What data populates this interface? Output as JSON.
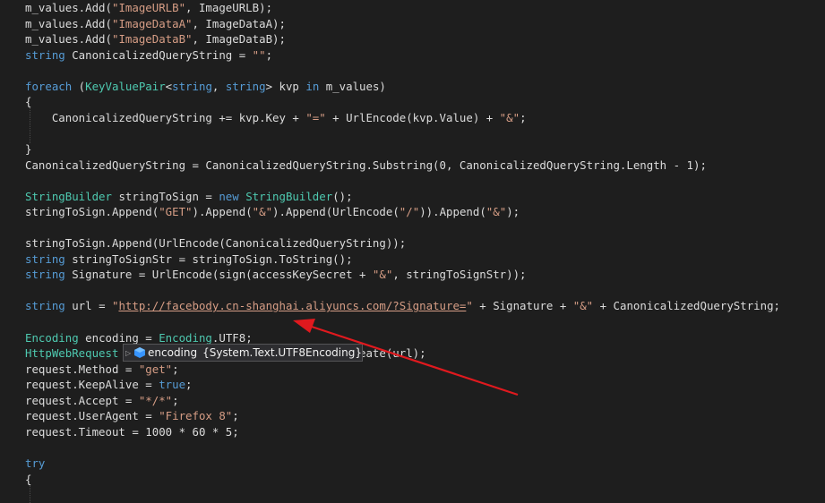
{
  "code_lines": [
    [
      {
        "t": "m_values.Add(",
        "c": "plain"
      },
      {
        "t": "\"ImageURLB\"",
        "c": "str"
      },
      {
        "t": ", ImageURLB);",
        "c": "plain"
      }
    ],
    [
      {
        "t": "m_values.Add(",
        "c": "plain"
      },
      {
        "t": "\"ImageDataA\"",
        "c": "str"
      },
      {
        "t": ", ImageDataA);",
        "c": "plain"
      }
    ],
    [
      {
        "t": "m_values.Add(",
        "c": "plain"
      },
      {
        "t": "\"ImageDataB\"",
        "c": "str"
      },
      {
        "t": ", ImageDataB);",
        "c": "plain"
      }
    ],
    [
      {
        "t": "string",
        "c": "kw"
      },
      {
        "t": " CanonicalizedQueryString = ",
        "c": "plain"
      },
      {
        "t": "\"\"",
        "c": "str"
      },
      {
        "t": ";",
        "c": "plain"
      }
    ],
    [],
    [
      {
        "t": "foreach",
        "c": "kw"
      },
      {
        "t": " (",
        "c": "plain"
      },
      {
        "t": "KeyValuePair",
        "c": "type"
      },
      {
        "t": "<",
        "c": "plain"
      },
      {
        "t": "string",
        "c": "kw"
      },
      {
        "t": ", ",
        "c": "plain"
      },
      {
        "t": "string",
        "c": "kw"
      },
      {
        "t": "> kvp ",
        "c": "plain"
      },
      {
        "t": "in",
        "c": "kw"
      },
      {
        "t": " m_values)",
        "c": "plain"
      }
    ],
    [
      {
        "t": "{",
        "c": "plain"
      }
    ],
    [
      {
        "t": "    CanonicalizedQueryString += kvp.Key + ",
        "c": "plain"
      },
      {
        "t": "\"=\"",
        "c": "str"
      },
      {
        "t": " + UrlEncode(kvp.Value) + ",
        "c": "plain"
      },
      {
        "t": "\"&\"",
        "c": "str"
      },
      {
        "t": ";",
        "c": "plain"
      }
    ],
    [],
    [
      {
        "t": "}",
        "c": "plain"
      }
    ],
    [
      {
        "t": "CanonicalizedQueryString = CanonicalizedQueryString.Substring(0, CanonicalizedQueryString.Length - 1);",
        "c": "plain"
      }
    ],
    [],
    [
      {
        "t": "StringBuilder",
        "c": "type"
      },
      {
        "t": " stringToSign = ",
        "c": "plain"
      },
      {
        "t": "new",
        "c": "kw"
      },
      {
        "t": " ",
        "c": "plain"
      },
      {
        "t": "StringBuilder",
        "c": "type"
      },
      {
        "t": "();",
        "c": "plain"
      }
    ],
    [
      {
        "t": "stringToSign.Append(",
        "c": "plain"
      },
      {
        "t": "\"GET\"",
        "c": "str"
      },
      {
        "t": ").Append(",
        "c": "plain"
      },
      {
        "t": "\"&\"",
        "c": "str"
      },
      {
        "t": ").Append(UrlEncode(",
        "c": "plain"
      },
      {
        "t": "\"/\"",
        "c": "str"
      },
      {
        "t": ")).Append(",
        "c": "plain"
      },
      {
        "t": "\"&\"",
        "c": "str"
      },
      {
        "t": ");",
        "c": "plain"
      }
    ],
    [],
    [
      {
        "t": "stringToSign.Append(UrlEncode(CanonicalizedQueryString));",
        "c": "plain"
      }
    ],
    [
      {
        "t": "string",
        "c": "kw"
      },
      {
        "t": " stringToSignStr = stringToSign.ToString();",
        "c": "plain"
      }
    ],
    [
      {
        "t": "string",
        "c": "kw"
      },
      {
        "t": " Signature = UrlEncode(sign(accessKeySecret + ",
        "c": "plain"
      },
      {
        "t": "\"&\"",
        "c": "str"
      },
      {
        "t": ", stringToSignStr));",
        "c": "plain"
      }
    ],
    [],
    [
      {
        "t": "string",
        "c": "kw"
      },
      {
        "t": " url = ",
        "c": "plain"
      },
      {
        "t": "\"",
        "c": "str"
      },
      {
        "t": "http://facebody.cn-shanghai.aliyuncs.com/?Signature=",
        "c": "url"
      },
      {
        "t": "\"",
        "c": "str"
      },
      {
        "t": " + Signature + ",
        "c": "plain"
      },
      {
        "t": "\"&\"",
        "c": "str"
      },
      {
        "t": " + CanonicalizedQueryString;",
        "c": "plain"
      }
    ],
    [],
    [
      {
        "t": "Encoding",
        "c": "type"
      },
      {
        "t": " encoding = ",
        "c": "plain"
      },
      {
        "t": "Encoding",
        "c": "type"
      },
      {
        "t": ".UTF8;",
        "c": "plain"
      }
    ],
    [
      {
        "t": "HttpWebRequest",
        "c": "type"
      },
      {
        "t": " :",
        "c": "plain"
      },
      {
        "t": "                                 ",
        "c": "plain"
      },
      {
        "t": "reate(url);",
        "c": "plain"
      }
    ],
    [
      {
        "t": "request.Method = ",
        "c": "plain"
      },
      {
        "t": "\"get\"",
        "c": "str"
      },
      {
        "t": ";",
        "c": "plain"
      }
    ],
    [
      {
        "t": "request.KeepAlive = ",
        "c": "plain"
      },
      {
        "t": "true",
        "c": "kw"
      },
      {
        "t": ";",
        "c": "plain"
      }
    ],
    [
      {
        "t": "request.Accept = ",
        "c": "plain"
      },
      {
        "t": "\"*/*\"",
        "c": "str"
      },
      {
        "t": ";",
        "c": "plain"
      }
    ],
    [
      {
        "t": "request.UserAgent = ",
        "c": "plain"
      },
      {
        "t": "\"Firefox 8\"",
        "c": "str"
      },
      {
        "t": ";",
        "c": "plain"
      }
    ],
    [
      {
        "t": "request.Timeout = 1000 * 60 * 5;",
        "c": "plain"
      }
    ],
    [],
    [
      {
        "t": "try",
        "c": "kw"
      }
    ],
    [
      {
        "t": "{",
        "c": "plain"
      }
    ]
  ],
  "datatip": {
    "expander": "▷",
    "icon": "object-icon",
    "label": "encoding",
    "value": "{System.Text.UTF8Encoding}"
  },
  "colors": {
    "background": "#1e1e1e",
    "keyword": "#569cd6",
    "type": "#4ec9b0",
    "string": "#d69d85",
    "text": "#dcdcdc",
    "annotation_arrow": "#e0191e"
  }
}
